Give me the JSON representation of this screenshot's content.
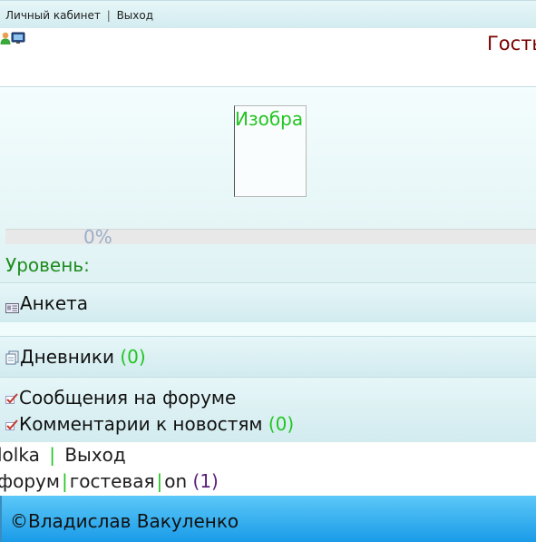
{
  "topbar": {
    "cabinet": "Личный кабинет",
    "sep": "|",
    "logout": "Выход"
  },
  "header": {
    "guest_label": "Гость",
    "icons": [
      "user-icon",
      "monitor-icon"
    ]
  },
  "profile": {
    "image_alt": "Изобра",
    "progress_text": "0%",
    "progress_value": 0,
    "level_label": "Уровень:"
  },
  "menu": {
    "anketa": "Анкета",
    "diaries_label": "Дневники",
    "diaries_count": "(0)",
    "forum_messages": "Сообщения на форуме",
    "news_comments_label": "Комментарии к новостям",
    "news_comments_count": "(0)"
  },
  "footer_links": {
    "user": "lolka",
    "sep": "|",
    "logout": "Выход",
    "forum": "форум",
    "guestbook": "гостевая",
    "online": "on",
    "online_count": "(1)"
  },
  "copyright": "©Владислав Вакуленко",
  "colors": {
    "guest": "#7a0000",
    "green": "#22c522",
    "level": "#1e8c1e",
    "footer_bg": "#23a8ee"
  }
}
